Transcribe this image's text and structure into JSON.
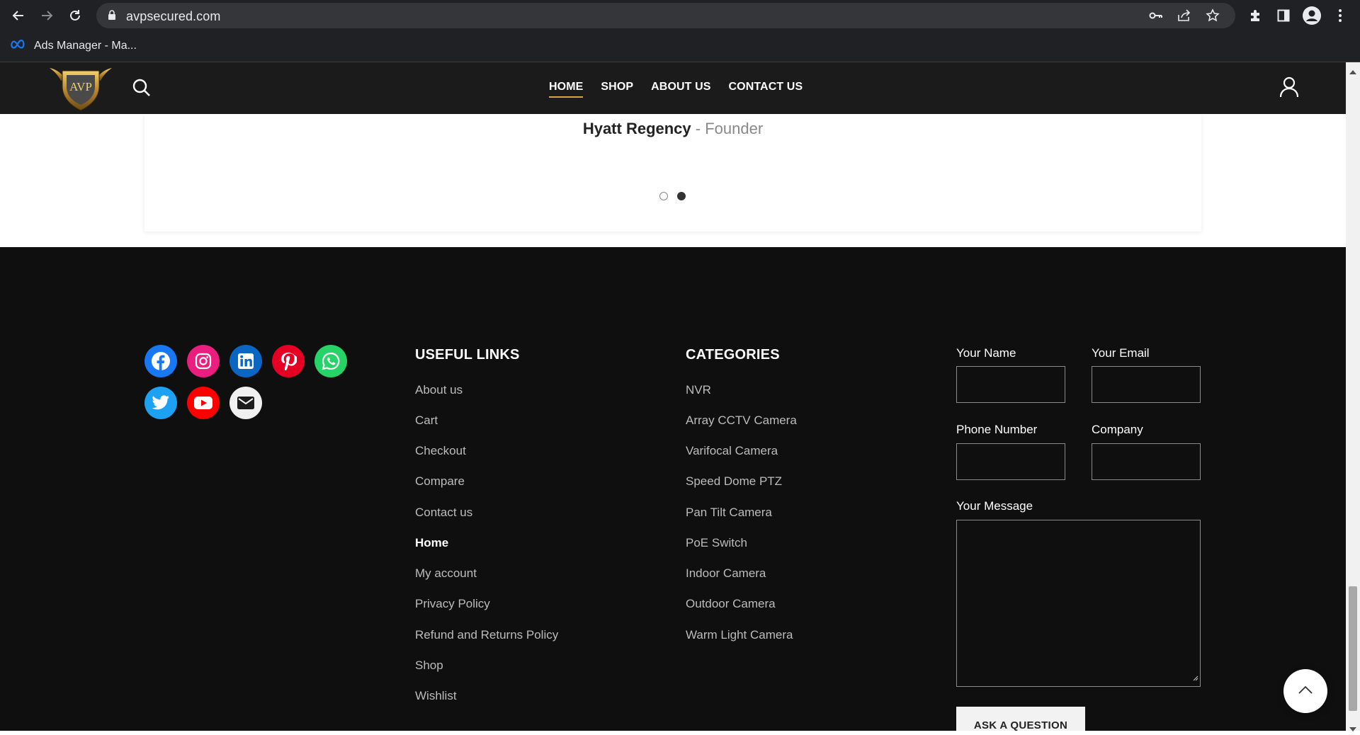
{
  "browser": {
    "url": "avpsecured.com",
    "bookmark_label": "Ads Manager - Ma..."
  },
  "header": {
    "logo_text": "AVP",
    "nav": [
      {
        "label": "HOME"
      },
      {
        "label": "SHOP"
      },
      {
        "label": "ABOUT US"
      },
      {
        "label": "CONTACT US"
      }
    ]
  },
  "testimonial": {
    "author": "Hyatt Regency",
    "role": " - Founder",
    "active_slide": 2,
    "slide_count": 2
  },
  "footer": {
    "social": [
      {
        "icon": "facebook-icon",
        "color": "#1877f2"
      },
      {
        "icon": "instagram-icon",
        "color": "#ea1e7e"
      },
      {
        "icon": "linkedin-icon",
        "color": "#0a66c2"
      },
      {
        "icon": "pinterest-icon",
        "color": "#e60023"
      },
      {
        "icon": "whatsapp-icon",
        "color": "#25d366"
      },
      {
        "icon": "twitter-icon",
        "color": "#1da1f2"
      },
      {
        "icon": "youtube-icon",
        "color": "#ff0000"
      },
      {
        "icon": "mail-icon",
        "color": "#f0f0f0"
      }
    ],
    "useful_links_title": "USEFUL LINKS",
    "useful_links": [
      "About us",
      "Cart",
      "Checkout",
      "Compare",
      "Contact us",
      "Home",
      "My account",
      "Privacy Policy",
      "Refund and Returns Policy",
      "Shop",
      "Wishlist"
    ],
    "categories_title": "CATEGORIES",
    "categories": [
      "NVR",
      "Array CCTV Camera",
      "Varifocal Camera",
      "Speed Dome PTZ",
      "Pan Tilt Camera",
      "PoE Switch",
      "Indoor Camera",
      "Outdoor Camera",
      "Warm Light Camera"
    ],
    "form": {
      "name_label": "Your Name",
      "email_label": "Your Email",
      "phone_label": "Phone Number",
      "company_label": "Company",
      "message_label": "Your Message",
      "submit_label": "ASK A QUESTION"
    }
  },
  "colors": {
    "header_bg": "#1b1b1b",
    "footer_bg": "#0f0f0f",
    "accent": "#d9a441"
  }
}
